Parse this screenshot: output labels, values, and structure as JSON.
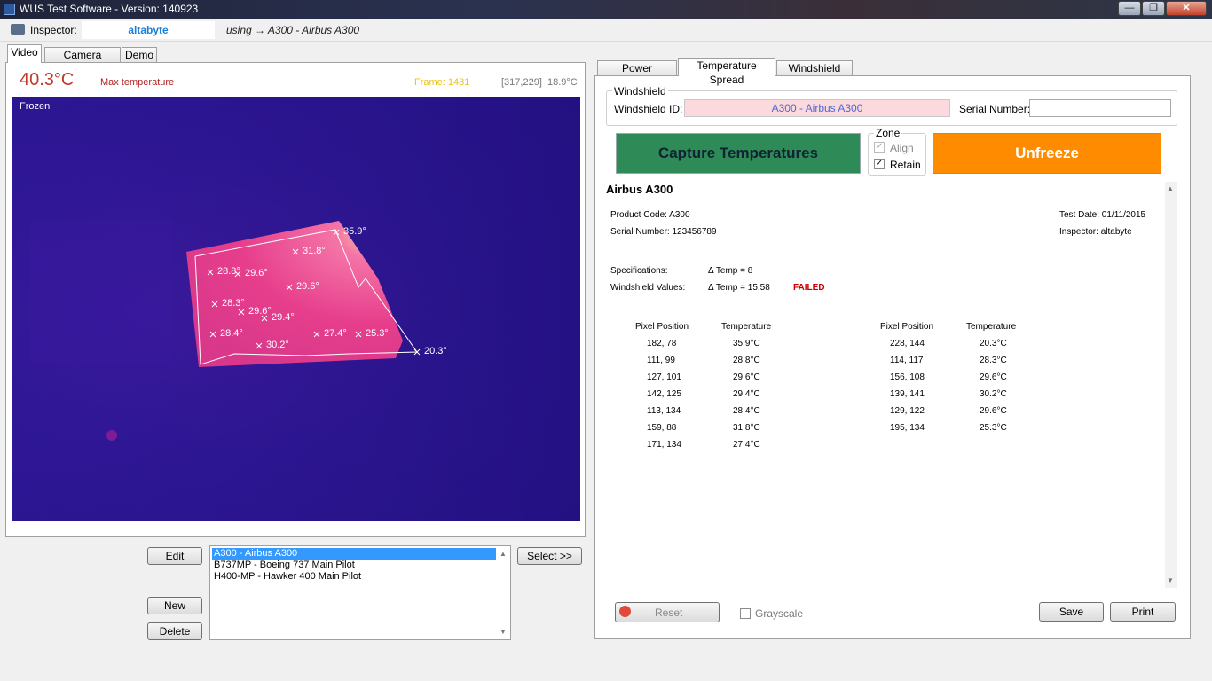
{
  "window": {
    "title": "WUS Test Software   -  Version: 140923",
    "min": "—",
    "max": "❐",
    "close": "✕"
  },
  "toolbar": {
    "inspector_label": "Inspector:",
    "inspector_value": "altabyte",
    "using_text": "using → A300 - Airbus A300"
  },
  "left_tabs": [
    "Video",
    "Camera settings",
    "Demo"
  ],
  "video": {
    "max_temp": "40.3°C",
    "max_temp_label": "Max temperature",
    "frame": "Frame: 1481",
    "cursor_pos": "[317,229]",
    "cursor_temp": "18.9°C",
    "status": "Frozen",
    "markers": [
      {
        "label": "35.9°"
      },
      {
        "label": "31.8°"
      },
      {
        "label": "28.8°"
      },
      {
        "label": "29.6°"
      },
      {
        "label": "29.6°"
      },
      {
        "label": "28.3°"
      },
      {
        "label": "29.6°"
      },
      {
        "label": "29.4°"
      },
      {
        "label": "28.4°"
      },
      {
        "label": "30.2°"
      },
      {
        "label": "27.4°"
      },
      {
        "label": "25.3°"
      },
      {
        "label": "20.3°"
      }
    ]
  },
  "buttons": {
    "edit": "Edit",
    "new": "New",
    "delete": "Delete",
    "select": "Select  >>",
    "reset": "Reset",
    "save": "Save",
    "print": "Print"
  },
  "windshield_list": [
    "A300 - Airbus A300",
    "B737MP - Boeing 737 Main Pilot",
    "H400-MP - Hawker 400 Main Pilot"
  ],
  "right_tabs": [
    "Power Constants",
    "Temperature Spread",
    "Windshield Data"
  ],
  "windshield": {
    "group_label": "Windshield",
    "id_label": "Windshield ID:",
    "id_value": "A300 - Airbus A300",
    "serial_label": "Serial Number:",
    "serial_value": ""
  },
  "capture_label": "Capture Temperatures",
  "unfreeze_label": "Unfreeze",
  "zone": {
    "label": "Zone",
    "align": "Align",
    "retain": "Retain",
    "align_checked": true,
    "retain_checked": true
  },
  "report": {
    "title": "Airbus A300",
    "product_code": "Product Code:  A300",
    "serial_number": "Serial Number:  123456789",
    "test_date": "Test Date:  01/11/2015",
    "inspector": "Inspector:  altabyte",
    "spec_label": "Specifications:",
    "spec_value": "Δ Temp = 8",
    "values_label": "Windshield Values:",
    "values_value": "Δ Temp = 15.58",
    "result": "FAILED",
    "col_pixel": "Pixel Position",
    "col_temp": "Temperature",
    "left_rows": [
      [
        "182, 78",
        "35.9°C"
      ],
      [
        "111, 99",
        "28.8°C"
      ],
      [
        "127, 101",
        "29.6°C"
      ],
      [
        "142, 125",
        "29.4°C"
      ],
      [
        "113, 134",
        "28.4°C"
      ],
      [
        "159, 88",
        "31.8°C"
      ],
      [
        "171, 134",
        "27.4°C"
      ]
    ],
    "right_rows": [
      [
        "228, 144",
        "20.3°C"
      ],
      [
        "114, 117",
        "28.3°C"
      ],
      [
        "156, 108",
        "29.6°C"
      ],
      [
        "139, 141",
        "30.2°C"
      ],
      [
        "129, 122",
        "29.6°C"
      ],
      [
        "195, 134",
        "25.3°C"
      ]
    ]
  },
  "grayscale_label": "Grayscale"
}
